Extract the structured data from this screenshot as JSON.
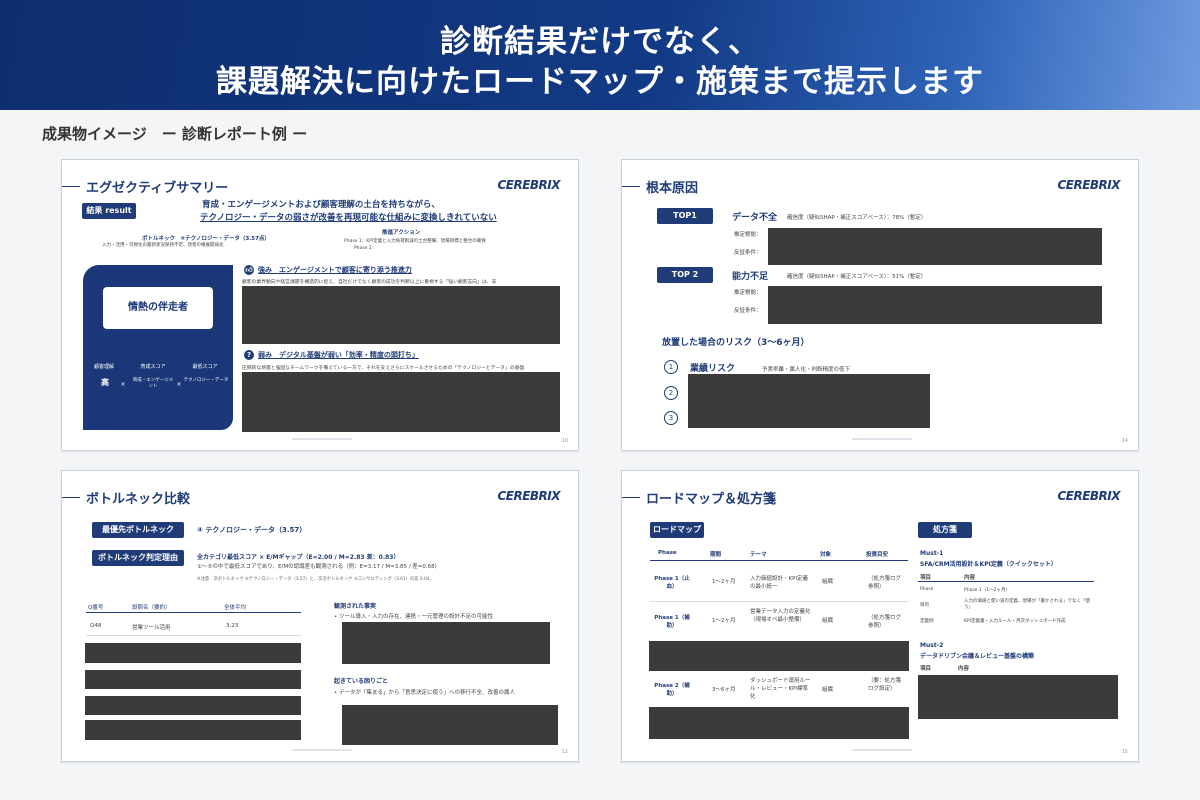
{
  "header": {
    "line1": "診断結果だけでなく、",
    "line2": "課題解決に向けたロードマップ・施策まで提示します"
  },
  "subtitle": "成果物イメージ　ー 診断レポート例 ー",
  "logo": "CEREBRIX",
  "slide1": {
    "title": "エグゼクティブサマリー",
    "result_tag": "結果 result",
    "headline1": "育成・エンゲージメントおよび顧客理解の土台を持ちながら、",
    "headline2": "テクノロジー・データの弱さが改善を再現可能な仕組みに変換しきれていない",
    "bottleneck": "ボトルネック　④テクノロジー・データ（3.57点）",
    "bottleneck_sub": "入力・活用・可視化の最新状況保持不足、改善の横展開弱化",
    "action_title": "推進アクション",
    "action_1": "Phase 1：KPI定義と入力負荷削減の土台整備、現場目標と整合の確保",
    "action_2": "Phase 2：",
    "hero_label": "情熱の伴走者",
    "hero_a_label": "顧客理解",
    "hero_a_value": "高",
    "hero_b_label": "育成スコア",
    "hero_b_value": "育成・エンゲージメント",
    "hero_c_label": "最低スコア",
    "hero_c_value": "テクノロジー・データ",
    "strength_head": "強み　エンゲージメントで顧客に寄り添う推進力",
    "strength_text": "顧客の業界動向や経営課題を構造的に捉え、自社だけでなく顧客の成功を判断以上に重視する「強い顧客志向」は、非",
    "weak_head": "弱み　デジタル基盤が弱い「効率・精度の頭打ち」",
    "weak_text": "圧倒的な熱量と強固なチームワークを備えている一方で、それを支えさらにスケールさせるための「テクノロジーとデータ」の基盤",
    "page": "10"
  },
  "slide2": {
    "title": "根本原因",
    "top1_tag": "TOP1",
    "top1_title": "データ不全",
    "top1_conf": "確信度（疑似SHAP・補正スコアベース）：78%（暫定）",
    "top1_est": "推定根拠：",
    "top1_ctr": "反証条件：",
    "top2_tag": "TOP 2",
    "top2_title": "能力不足",
    "top2_conf": "確信度（疑似SHAP・補正スコアベース）：51%（暫定）",
    "top2_est": "推定根拠：",
    "top2_ctr": "反証条件：",
    "risk_title": "放置した場合のリスク（3〜6ヶ月）",
    "risk_1_num": "1",
    "risk_1_title": "業績リスク",
    "risk_1_text": "予実乖離・属人化・判断精度の低下",
    "risk_2_num": "2",
    "risk_3_num": "3",
    "page": "14"
  },
  "slide3": {
    "title": "ボトルネック比較",
    "prio_tag": "最優先ボトルネック",
    "prio_value": "④ テクノロジー・データ（3.57）",
    "reason_tag": "ボトルネック判定理由",
    "reason_1": "全カテゴリ最低スコア × E/Mギャップ（E=2.00 / M=2.83 差：0.83）",
    "reason_2": "①〜⑤の中で最低スコアであり、E/Mの認識差も観測される（例：E=3.17 / M=3.85 / 差=0.68）",
    "note": "※注意　次ボトルネック ④テクノロジー・データ（3.57）と、次次ボトルネック ③コンサルティング（3.61）の差 0.04。",
    "col_q": "Q番号",
    "col_name": "設問名（要約）",
    "col_avg": "全体平均",
    "row_q": "Q48",
    "row_name": "営業ツール活用",
    "row_avg": "3.23",
    "fact_title": "観測された事実",
    "fact_1": "ツール導入・入力の存在、連携・一元管理の設計不足の可能性",
    "trouble_title": "起きている困りごと",
    "trouble_1": "データが「集まる」から「意思決定に使う」への移行不全、改善の属人",
    "page": "12"
  },
  "slide4": {
    "title": "ロードマップ＆処方箋",
    "road_tag": "ロードマップ",
    "col_phase": "Phase",
    "col_period": "期間",
    "col_theme": "テーマ",
    "col_target": "対象",
    "col_kpi": "投資目安",
    "r1_phase": "Phase 1（止血）",
    "r1_period": "1〜2ヶ月",
    "r1_theme": "入力価値設計・KPI定義の最小統一",
    "r1_target": "組織",
    "r1_kpi": "（処方箋ログ参照）",
    "r2_phase": "Phase 1（補助）",
    "r2_period": "1〜2ヶ月",
    "r2_theme": "営業データ入力の定義化（現場オペ最小整備）",
    "r2_target": "組織",
    "r2_kpi": "（処方箋ログ参照）",
    "r3_phase": "Phase 2（補助）",
    "r3_period": "3〜6ヶ月",
    "r3_theme": "ダッシュボード運用ルール・レビュー・KPI標準化",
    "r3_target": "組織",
    "r3_kpi": "（要：処方箋ログ設定）",
    "presc_tag": "処方箋",
    "must1_title": "Must-1",
    "must1_sub": "SFA/CRM活用設計＆KPI定義（クイックセット）",
    "m_col_item": "項目",
    "m_col_content": "内容",
    "m1_r1_k": "Phase",
    "m1_r1_v": "Phase 1（1〜2ヶ月）",
    "m1_r2_k": "目的",
    "m1_r2_v": "入力の価値と使い道の定義、現場が「書かされる」でなく「使う」",
    "m1_r3_k": "定義例",
    "m1_r3_v": "KPI定義書・入力ルール・月次ダッシュボード作成",
    "must2_title": "Must-2",
    "must2_sub": "データドリブン会議＆レビュー基盤の構築",
    "m2_col_item": "項目",
    "m2_col_content": "内容",
    "page": "15"
  }
}
